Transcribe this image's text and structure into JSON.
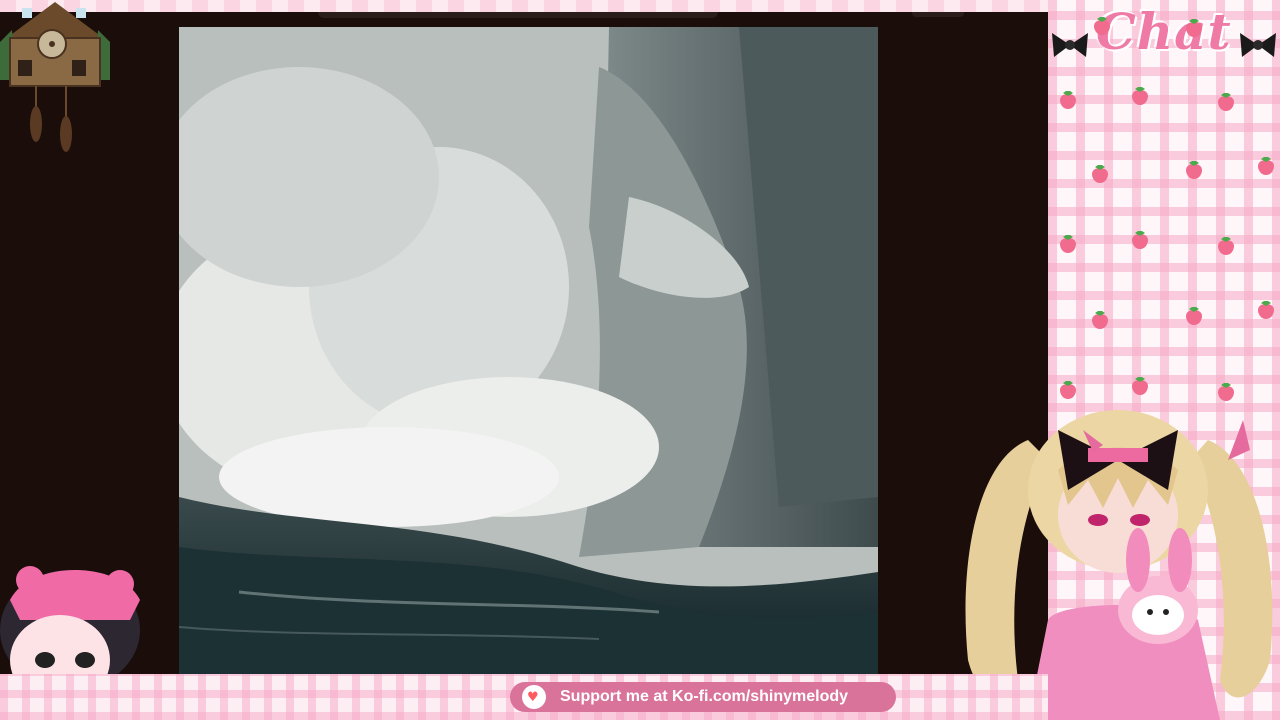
{
  "chat": {
    "title": "Chat",
    "bow_icon": "black-bow-icon",
    "pattern_icon": "strawberry-icon"
  },
  "banner": {
    "text": "Support me at Ko-fi.com/shinymelody",
    "icon": "ko-fi-cup-heart-icon"
  },
  "video": {
    "description_icon": "glacier-calving-video"
  },
  "colors": {
    "accent_pink": "#f07aa6",
    "banner_pink": "#d9739a",
    "frame_dark": "#1a0d0a"
  }
}
